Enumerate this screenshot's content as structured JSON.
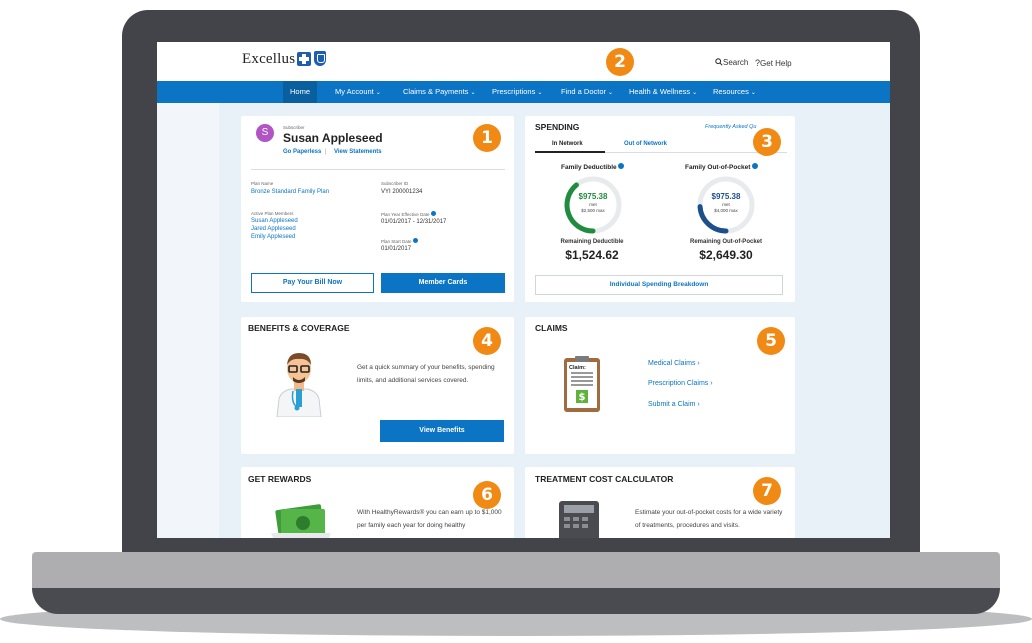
{
  "header": {
    "logo_text": "Excellus",
    "search_label": "Search",
    "help_label": "Get Help"
  },
  "nav": {
    "items": [
      {
        "label": "Home"
      },
      {
        "label": "My Account"
      },
      {
        "label": "Claims & Payments"
      },
      {
        "label": "Prescriptions"
      },
      {
        "label": "Find a Doctor"
      },
      {
        "label": "Health & Wellness"
      },
      {
        "label": "Resources"
      }
    ]
  },
  "badges": [
    "1",
    "2",
    "3",
    "4",
    "5",
    "6",
    "7"
  ],
  "account": {
    "subscriber_label": "Subscriber",
    "avatar_initial": "S",
    "name": "Susan Appleseed",
    "go_paperless": "Go Paperless",
    "separator": "|",
    "view_statements": "View Statements",
    "plan_name_label": "Plan Name",
    "plan_name": "Bronze Standard Family Plan",
    "subscriber_id_label": "Subscriber ID",
    "subscriber_id": "VYI 200001234",
    "active_members_label": "Active Plan Members",
    "members": [
      "Susan Appleseed",
      "Jared Appleseed",
      "Emily Appleseed"
    ],
    "plan_year_label": "Plan Year Effective Date",
    "plan_year": "01/01/2017 - 12/31/2017",
    "plan_start_label": "Plan Start Date",
    "plan_start": "01/01/2017",
    "pay_bill": "Pay Your Bill Now",
    "member_cards": "Member Cards"
  },
  "spending": {
    "title": "SPENDING",
    "faq": "Frequently Asked Qu",
    "tab_in": "In Network",
    "tab_out": "Out of Network",
    "ded_title": "Family Deductible",
    "ded_amount": "$975.38",
    "ded_met": "met",
    "ded_max": "$2,500 max",
    "ded_fraction": 0.39,
    "ded_remaining_label": "Remaining Deductible",
    "ded_remaining": "$1,524.62",
    "oop_title": "Family Out-of-Pocket",
    "oop_amount": "$975.38",
    "oop_met": "met",
    "oop_max": "$4,000 max",
    "oop_fraction": 0.24,
    "oop_remaining_label": "Remaining Out-of-Pocket",
    "oop_remaining": "$2,649.30",
    "breakdown": "Individual Spending Breakdown",
    "colors": {
      "deductible": "#1f8c3f",
      "oop": "#1d4f8c",
      "track": "#e8ebee"
    }
  },
  "benefits": {
    "title": "BENEFITS & COVERAGE",
    "description": "Get a quick summary of your benefits, spending limits, and additional services covered.",
    "button": "View Benefits"
  },
  "claims": {
    "title": "CLAIMS",
    "clipboard_label": "Claim:",
    "links": [
      "Medical Claims",
      "Prescription Claims",
      "Submit a Claim"
    ],
    "chevron": "›"
  },
  "rewards": {
    "title": "GET REWARDS",
    "description": "With HealthyRewards® you can earn up to $1,000 per family each year for doing healthy"
  },
  "calculator": {
    "title": "TREATMENT COST CALCULATOR",
    "description": "Estimate your out-of-pocket costs for a wide variety of treatments, procedures and visits."
  }
}
